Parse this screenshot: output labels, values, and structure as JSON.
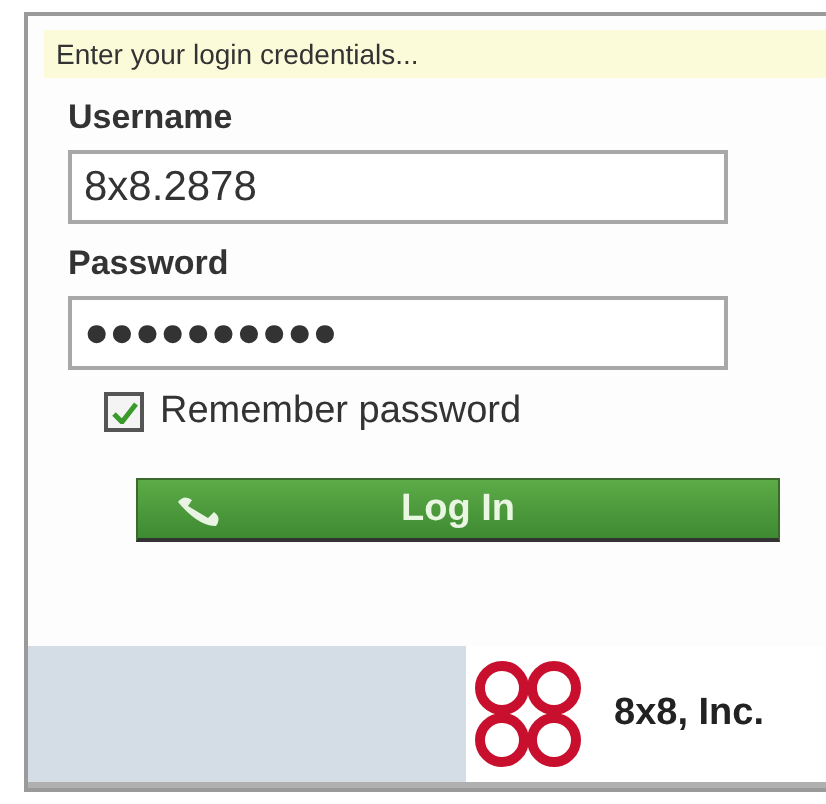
{
  "banner": "Enter your login credentials...",
  "fields": [
    {
      "label": "Username",
      "value": "8x8.2878"
    },
    {
      "label": "Password",
      "value": "●●●●●●●●●●"
    }
  ],
  "remember": {
    "label": "Remember password",
    "checked": true
  },
  "login_button": "Log In",
  "footer": {
    "company": "8x8, Inc."
  }
}
